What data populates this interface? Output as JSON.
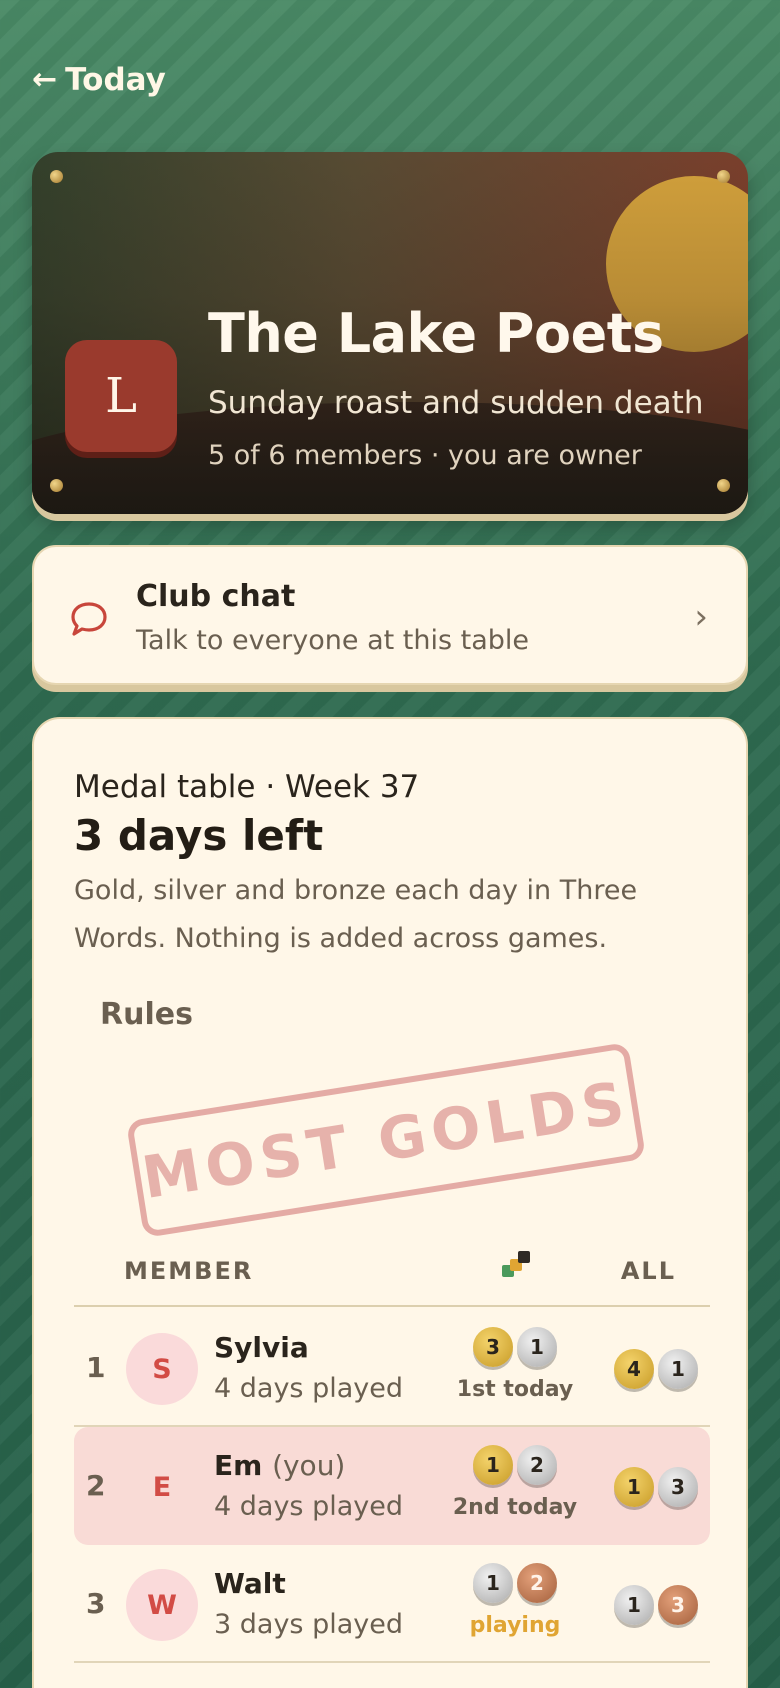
{
  "nav": {
    "back_label": "Today",
    "back_arrow": "←"
  },
  "club": {
    "initial": "L",
    "name": "The Lake Poets",
    "tagline": "Sunday roast and sudden death",
    "meta": "5 of 6 members · you are owner"
  },
  "chat": {
    "title": "Club chat",
    "subtitle": "Talk to everyone at this table",
    "icon": "speech-bubble-icon",
    "chevron": "›"
  },
  "medal_table": {
    "heading": "Medal table · Week 37",
    "countdown": "3 days left",
    "description": "Gold, silver and bronze each day in Three Words. Nothing is added across games.",
    "rules_label": "Rules",
    "stamp_text": "MOST GOLDS",
    "col_member": "MEMBER",
    "col_all": "ALL",
    "game_icon": "three-words-game-icon",
    "rows": [
      {
        "rank": "1",
        "initial": "S",
        "name": "Sylvia",
        "you_tag": "",
        "played": "4 days played",
        "today_medals": [
          {
            "type": "gold",
            "count": "3"
          },
          {
            "type": "silver",
            "count": "1"
          }
        ],
        "status": "1st today",
        "all_medals": [
          {
            "type": "gold",
            "count": "4"
          },
          {
            "type": "silver",
            "count": "1"
          }
        ]
      },
      {
        "rank": "2",
        "initial": "E",
        "name": "Em",
        "you_tag": "(you)",
        "played": "4 days played",
        "today_medals": [
          {
            "type": "gold",
            "count": "1"
          },
          {
            "type": "silver",
            "count": "2"
          }
        ],
        "status": "2nd today",
        "all_medals": [
          {
            "type": "gold",
            "count": "1"
          },
          {
            "type": "silver",
            "count": "3"
          }
        ]
      },
      {
        "rank": "3",
        "initial": "W",
        "name": "Walt",
        "you_tag": "",
        "played": "3 days played",
        "today_medals": [
          {
            "type": "silver",
            "count": "1"
          },
          {
            "type": "bronze",
            "count": "2"
          }
        ],
        "status": "playing",
        "all_medals": [
          {
            "type": "silver",
            "count": "1"
          },
          {
            "type": "bronze",
            "count": "3"
          }
        ]
      }
    ]
  },
  "colors": {
    "felt_green": "#2f6e52",
    "cream": "#fff7e8",
    "brick": "#9a3a2d",
    "gold": "#d2a13c",
    "highlight_row": "#f9dbd6",
    "playing_status": "#e0a533"
  }
}
